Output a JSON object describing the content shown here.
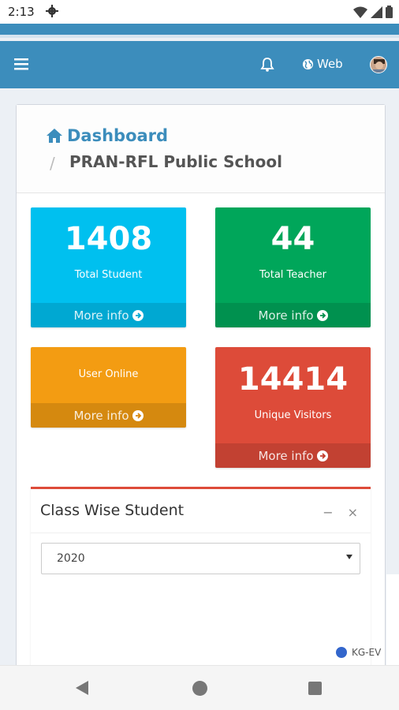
{
  "status_bar": {
    "time": "2:13",
    "icons": [
      "gear-icon",
      "wifi-icon",
      "signal-icon",
      "battery-icon"
    ]
  },
  "navbar": {
    "color": "#3c8dbc",
    "web_label": "Web",
    "icons": [
      "menu-icon",
      "bell-icon",
      "globe-icon",
      "avatar"
    ]
  },
  "breadcrumb": {
    "home_label": "Dashboard",
    "separator": "/",
    "school_name": "PRAN-RFL Public School"
  },
  "stats": [
    {
      "value": "1408",
      "label": "Total Student",
      "more": "More info",
      "color": "#00c0ef"
    },
    {
      "value": "44",
      "label": "Total Teacher",
      "more": "More info",
      "color": "#00a65a"
    },
    {
      "value": "",
      "label": "User Online",
      "more": "More info",
      "color": "#f39c12"
    },
    {
      "value": "14414",
      "label": "Unique Visitors",
      "more": "More info",
      "color": "#dd4b39"
    }
  ],
  "class_wise": {
    "title": "Class Wise Student",
    "minimize": "−",
    "close": "×",
    "year_selected": "2020",
    "legend_item": "KG-EV",
    "legend_color": "#3366cc"
  }
}
